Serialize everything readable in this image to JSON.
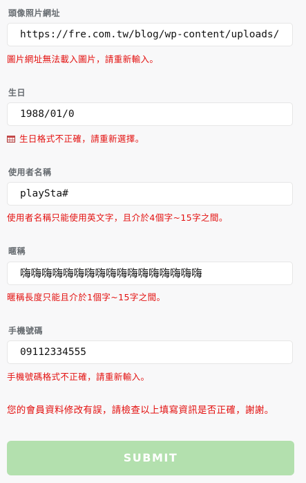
{
  "fields": [
    {
      "label": "頭像照片網址",
      "value": "https://fre.com.tw/blog/wp-content/uploads/",
      "error": "圖片網址無法載入圖片，請重新輸入。"
    },
    {
      "label": "生日",
      "value": "1988/01/0",
      "error": "生日格式不正確，請重新選擇。",
      "error_icon": "calendar-icon"
    },
    {
      "label": "使用者名稱",
      "value": "playSta#",
      "error": "使用者名稱只能使用英文字，且介於4個字~15字之間。"
    },
    {
      "label": "暱稱",
      "value": "嗨嗨嗨嗨嗨嗨嗨嗨嗨嗨嗨嗨嗨嗨嗨嗨嗨",
      "error": "暱稱長度只能且介於1個字~15字之間。"
    },
    {
      "label": "手機號碼",
      "value": "09112334555",
      "error": "手機號碼格式不正確，請重新輸入。"
    }
  ],
  "summary_error": "您的會員資料修改有誤，請檢查以上填寫資訊是否正確，謝謝。",
  "submit_label": "SUBMIT",
  "colors": {
    "error": "#e3100f",
    "label": "#666b70",
    "submit_bg": "#b3e0ae",
    "page_bg": "#f8f8f9"
  }
}
